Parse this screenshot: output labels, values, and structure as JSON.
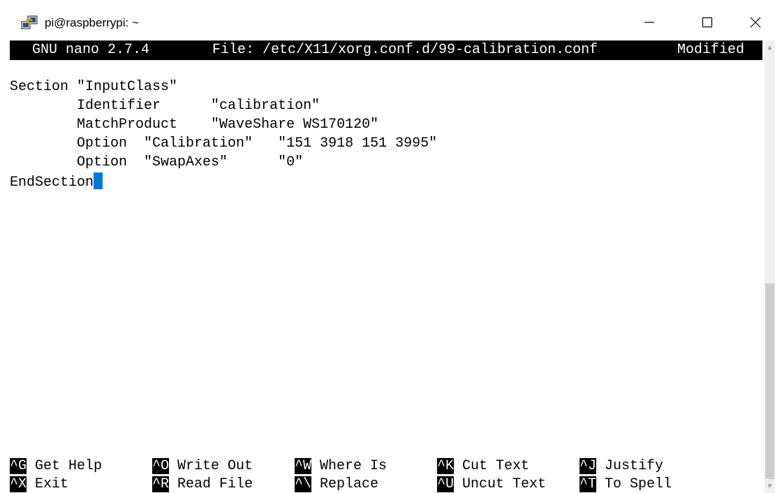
{
  "window": {
    "title": "pi@raspberrypi: ~",
    "icon": "putty-icon",
    "minimize_glyph": "—",
    "maximize_glyph": "☐",
    "close_glyph": "✕"
  },
  "nano": {
    "version": "GNU nano 2.7.4",
    "file": "File: /etc/X11/xorg.conf.d/99-calibration.conf",
    "status": "Modified"
  },
  "editor_lines": [
    "Section \"InputClass\"",
    "        Identifier      \"calibration\"",
    "        MatchProduct    \"WaveShare WS170120\"",
    "        Option  \"Calibration\"   \"151 3918 151 3995\"",
    "        Option  \"SwapAxes\"      \"0\"",
    "EndSection"
  ],
  "shortcuts": [
    {
      "key": "^G",
      "label": "Get Help"
    },
    {
      "key": "^O",
      "label": "Write Out"
    },
    {
      "key": "^W",
      "label": "Where Is"
    },
    {
      "key": "^K",
      "label": "Cut Text"
    },
    {
      "key": "^J",
      "label": "Justify"
    },
    {
      "key": "^X",
      "label": "Exit"
    },
    {
      "key": "^R",
      "label": "Read File"
    },
    {
      "key": "^\\",
      "label": "Replace"
    },
    {
      "key": "^U",
      "label": "Uncut Text"
    },
    {
      "key": "^T",
      "label": "To Spell"
    }
  ],
  "colors": {
    "cursor": "#0078d7",
    "header_bg": "#000000",
    "header_fg": "#ffffff"
  }
}
